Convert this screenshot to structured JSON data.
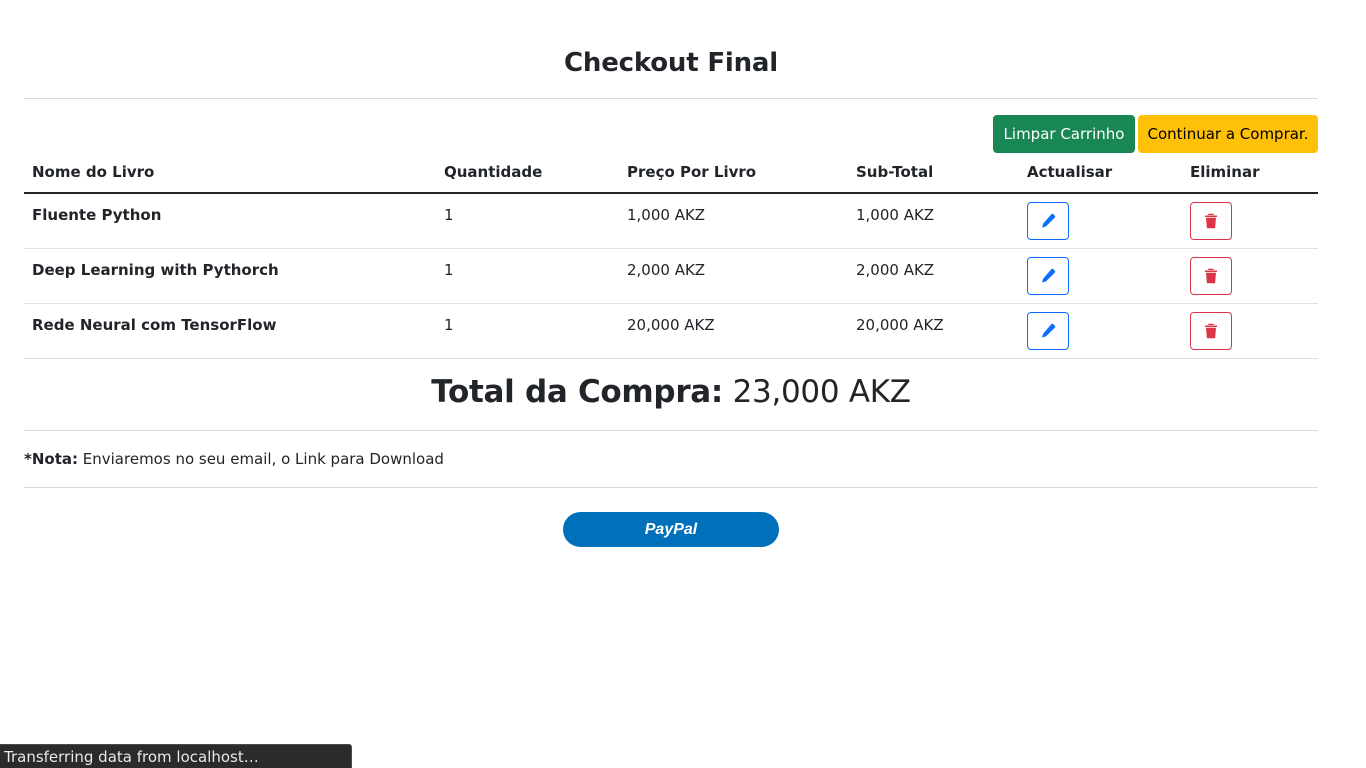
{
  "page": {
    "title": "Checkout Final"
  },
  "actions": {
    "clear_cart": "Limpar Carrinho",
    "continue_shopping": "Continuar a Comprar."
  },
  "table": {
    "headers": {
      "name": "Nome do Livro",
      "quantity": "Quantidade",
      "unit_price": "Preço Por Livro",
      "subtotal": "Sub-Total",
      "update": "Actualisar",
      "delete": "Eliminar"
    },
    "rows": [
      {
        "name": "Fluente Python",
        "quantity": "1",
        "unit_price": "1,000 AKZ",
        "subtotal": "1,000 AKZ"
      },
      {
        "name": "Deep Learning with Pythorch",
        "quantity": "1",
        "unit_price": "2,000 AKZ",
        "subtotal": "2,000 AKZ"
      },
      {
        "name": "Rede Neural com TensorFlow",
        "quantity": "1",
        "unit_price": "20,000 AKZ",
        "subtotal": "20,000 AKZ"
      }
    ],
    "icons": {
      "update": "pencil-icon",
      "delete": "trash-icon"
    }
  },
  "total": {
    "label": "Total da Compra:",
    "value": "23,000 AKZ"
  },
  "note": {
    "label": "*Nota:",
    "text": "Enviaremos no seu email, o Link para Download"
  },
  "paypal": {
    "label": "PayPal"
  },
  "statusbar": {
    "text": "Transferring data from localhost…"
  },
  "colors": {
    "success": "#198754",
    "warning": "#ffc107",
    "primary": "#0d6efd",
    "danger": "#dc3545",
    "paypal": "#0070ba"
  }
}
